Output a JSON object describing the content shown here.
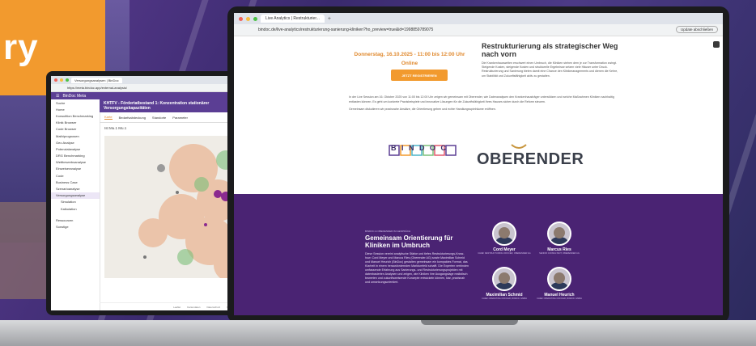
{
  "left_panel_text": "ry",
  "left_screen": {
    "tab_title": "Versorgungsanalysen | BinDoc",
    "url": "https://meta.bindoc.app/external-analysis/",
    "app_name": "BinDoc Meta",
    "header_title": "KHTFV - Fördertatbestand 1: Konzentration stationärer Versorgungskapazitäten",
    "tabs": [
      "Karte",
      "Bedarfsabdeckung",
      "Standorte",
      "Parameter"
    ],
    "active_tab": "Karte",
    "sidebar": [
      "Suche",
      "Home",
      "Konsulltion Benchmarking",
      "Klinik Browser",
      "Code Browser",
      "Mathiprognosen",
      "Geo Analyse",
      "Potenzialanalyse",
      "DRG Benchmarking",
      "Wettbewerbsanalyse",
      "Einweiseranalyse",
      "Code",
      "Business Case",
      "Szenarioanalyse",
      "Versorgungsanalyse",
      "Simulation",
      "Kalkulation",
      "Ressourcen",
      "Sonstige"
    ],
    "legend": "Ist  Mu.1  Mu.1",
    "footer": [
      "Leaflet",
      "Kartendaten",
      "Datenschutz",
      "Impressum"
    ]
  },
  "right_screen": {
    "tab_title": "Live Analytics | Restrukturier...",
    "url": "bindoc.de/live-analytics/restrukturierung-sanierung-kliniken?ho_preview=true&id=1998859789075",
    "update_label": "Update abschließen",
    "event_date": "Donnerstag, 16.10.2025 - 11:00 bis 12:00 Uhr",
    "event_mode": "Online",
    "register_label": "JETZT REGISTRIEREN",
    "heading": "Restrukturierung als strategischer Weg nach vorn",
    "para_right": "Die Krankenhauswelten erschwert einen Umbruch, die Kliniken stehen dem je zur Transformation zwingt. Steigende Kosten, steigende Kosten und strukturelle Ergebnisse setzen viele Häuser unter Druck. Restrukturierung und Sanierung bieten damit eine Chance den Klinikmanagements und dienen die Kehre, um Stabilität und Zukunftsfähigkeit aktiv zu gestalten.",
    "para_left": "In der Live Session am 16. Oktober 2025 von 11:00 bis 12:00 Uhr zeigen wir gemeinsam mit Oberender, wie Datenanalysen den Krankenhausträger unterstützen und welche Maßnahmen Kliniken nachhaltig entlasten können. Es geht um konkrete Praxisbeispiele und innovative Lösungen für die Zukunftsfähigkeit Ihres Hauses sicher durch die Reform steuern.",
    "para_left2": "Gemeinsam diskutieren wir praxisnahe Ansätze, die Orientierung geben und echte Handlungsspielräume eröffnen.",
    "logo_bindoc": "BINDOC",
    "logo_oberender": "OBERENDER",
    "purple": {
      "caption": "BINDOC & OBERENDER IM GESPRÄCH",
      "title": "Gemeinsam Orientierung für Kliniken im Umbruch",
      "text": "Diese Session vereint analytische Stärke und tiefes Restrukturierungs-Know-how: Cord Meyer und Marcus Ries (Oberender AG) sowie Maximilian Schmid und Manuel Heurich (BinDoc) gestalten gemeinsam ein kompaktes Format, das Klarheit in einem herausfordernden Marktumfeld schafft. Die Experten verbinden umfassende Erfahrung aus Sanierungs- und Restrukturierungsprojekten mit datenbasierten Analysen und zeigen, wie Kliniken ihre Ausgangslage realistisch bewerten und zukunftsweisende Konzepte entwickeln können, klar, praxisnah und umsetzungsorientiert.",
      "speakers": [
        {
          "name": "Cord Meyer",
          "role": "CHIEF RESTRUCTURING OFFICER, OBERENDER AG"
        },
        {
          "name": "Marcus Ries",
          "role": "SENIOR CONSULTANT, OBERENDER AG"
        },
        {
          "name": "Maximilian Schmid",
          "role": "CHIEF OPERATING OFFICER, BINDOC GMBH"
        },
        {
          "name": "Manuel Heurich",
          "role": "CHIEF OPERATING OFFICER, BINDOC GMBH"
        }
      ]
    }
  },
  "colors": {
    "orange": "#f29a2e",
    "purple": "#4a2373",
    "app_purple": "#5b3e94"
  }
}
